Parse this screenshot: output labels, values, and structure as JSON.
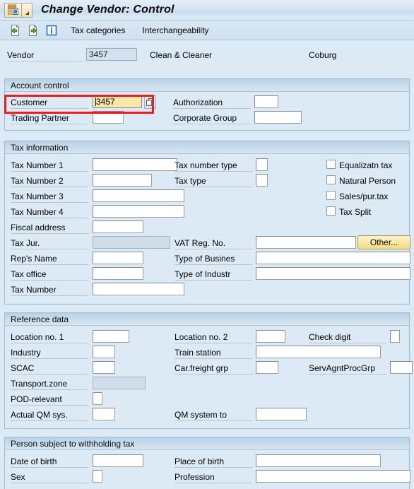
{
  "window": {
    "title": "Change Vendor: Control",
    "system_icon": "sap-vendor-icon",
    "menu_arrow_icon": "chevron-down-icon"
  },
  "toolbar": {
    "buttons": [
      {
        "name": "previous-screen-icon",
        "label": ""
      },
      {
        "name": "next-screen-icon",
        "label": ""
      },
      {
        "name": "info-icon",
        "label": ""
      }
    ],
    "text_buttons": [
      {
        "label": "Tax categories"
      },
      {
        "label": "Interchangeability"
      }
    ]
  },
  "header": {
    "vendor_label": "Vendor",
    "vendor_value": "3457",
    "vendor_name": "Clean & Cleaner",
    "vendor_city": "Coburg"
  },
  "sections": {
    "account_control": {
      "title": "Account control",
      "fields": {
        "customer_label": "Customer",
        "customer_value": "3457",
        "trading_partner_label": "Trading Partner",
        "trading_partner_value": "",
        "authorization_label": "Authorization",
        "authorization_value": "",
        "corporate_group_label": "Corporate Group",
        "corporate_group_value": ""
      },
      "matchcode_icon": "matchcode-search-help-icon"
    },
    "tax_information": {
      "title": "Tax information",
      "fields": {
        "tax_number_1_label": "Tax Number 1",
        "tax_number_1_value": "",
        "tax_number_2_label": "Tax Number 2",
        "tax_number_2_value": "",
        "tax_number_3_label": "Tax Number 3",
        "tax_number_3_value": "",
        "tax_number_4_label": "Tax Number 4",
        "tax_number_4_value": "",
        "fiscal_address_label": "Fiscal address",
        "fiscal_address_value": "",
        "tax_jur_label": "Tax Jur.",
        "tax_jur_value": "",
        "reps_name_label": "Rep's Name",
        "reps_name_value": "",
        "tax_office_label": "Tax office",
        "tax_office_value": "",
        "tax_number_label": "Tax Number",
        "tax_number_value": "",
        "tax_number_type_label": "Tax number type",
        "tax_number_type_value": "",
        "tax_type_label": "Tax type",
        "tax_type_value": "",
        "vat_reg_no_label": "VAT Reg. No.",
        "vat_reg_no_value": "",
        "type_of_busines_label": "Type of Busines",
        "type_of_busines_value": "",
        "type_of_industr_label": "Type of Industr",
        "type_of_industr_value": ""
      },
      "other_button_label": "Other...",
      "checkboxes": [
        {
          "label": "Equalizatn tax",
          "checked": false
        },
        {
          "label": "Natural Person",
          "checked": false
        },
        {
          "label": "Sales/pur.tax",
          "checked": false
        },
        {
          "label": "Tax Split",
          "checked": false
        }
      ]
    },
    "reference_data": {
      "title": "Reference data",
      "fields": {
        "location_no_1_label": "Location no. 1",
        "location_no_1_value": "",
        "industry_label": "Industry",
        "industry_value": "",
        "scac_label": "SCAC",
        "scac_value": "",
        "transport_zone_label": "Transport.zone",
        "transport_zone_value": "",
        "pod_relevant_label": "POD-relevant",
        "pod_relevant_value": "",
        "actual_qm_sys_label": "Actual QM sys.",
        "actual_qm_sys_value": "",
        "location_no_2_label": "Location no. 2",
        "location_no_2_value": "",
        "train_station_label": "Train station",
        "train_station_value": "",
        "car_freight_grp_label": "Car.freight grp",
        "car_freight_grp_value": "",
        "qm_system_to_label": "QM system to",
        "qm_system_to_value": "",
        "check_digit_label": "Check digit",
        "check_digit_value": "",
        "servagntprocgrp_label": "ServAgntProcGrp",
        "servagntprocgrp_value": ""
      }
    },
    "withholding_tax": {
      "title": "Person subject to withholding tax",
      "fields": {
        "date_of_birth_label": "Date of birth",
        "date_of_birth_value": "",
        "sex_label": "Sex",
        "sex_value": "",
        "place_of_birth_label": "Place of birth",
        "place_of_birth_value": "",
        "profession_label": "Profession",
        "profession_value": ""
      }
    }
  },
  "annotation": {
    "highlight_color": "#ee1c1c",
    "target": "customer-field-row"
  },
  "colors": {
    "background": "#dceaf5",
    "group_header": "#c7daea",
    "active_field": "#fbe8a8",
    "readonly_field": "#d3e1ee",
    "accent_button": "#f7e49b"
  }
}
